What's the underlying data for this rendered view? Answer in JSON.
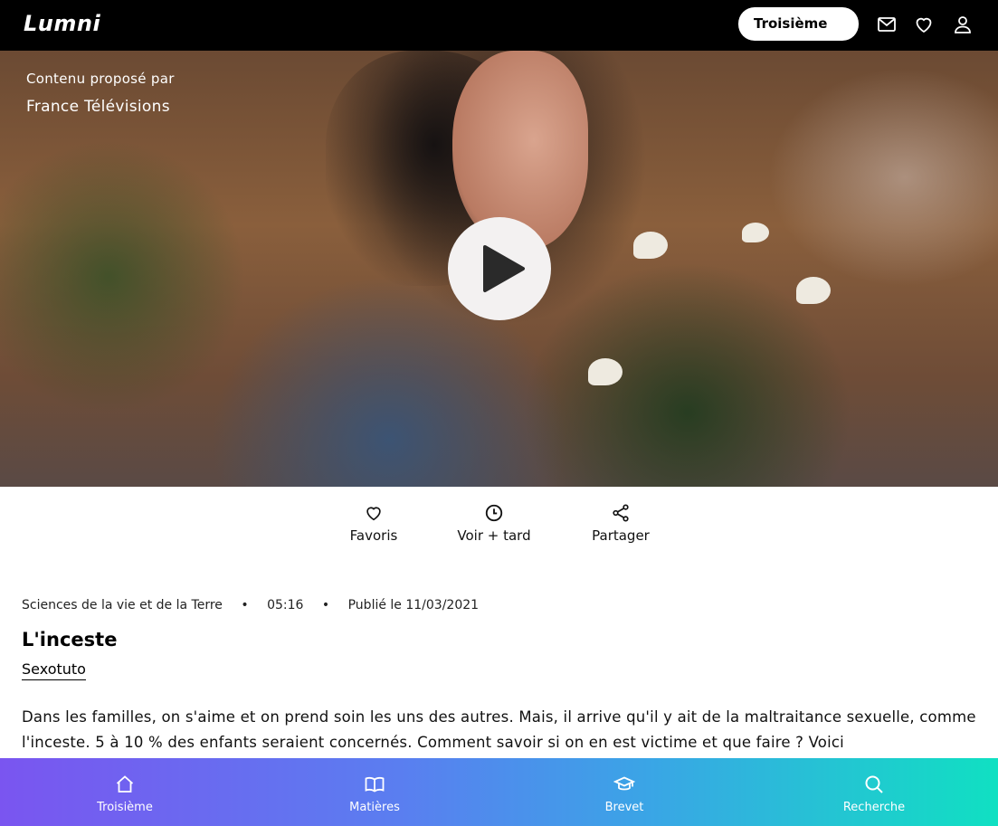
{
  "header": {
    "logo_text": "Lumni",
    "level_label": "Troisième",
    "icons": [
      "mail-icon",
      "heart-icon",
      "user-icon"
    ]
  },
  "video": {
    "provider_line1": "Contenu proposé par",
    "provider_line2": "France Télévisions",
    "play_icon": "play-icon"
  },
  "actions": {
    "favorites_label": "Favoris",
    "watch_later_label": "Voir + tard",
    "share_label": "Partager"
  },
  "content": {
    "subject": "Sciences de la vie et de la Terre",
    "duration": "05:16",
    "published": "Publié le 11/03/2021",
    "separator": "•",
    "title": "L'inceste",
    "program": "Sexotuto",
    "description": "Dans les familles, on s'aime et on prend soin les uns des autres. Mais, il arrive qu'il y ait de la maltraitance sexuelle, comme l'inceste. 5 à 10 % des enfants seraient concernés. Comment savoir si on en est victime et que faire ? Voici"
  },
  "bottom_nav": {
    "items": [
      {
        "label": "Troisième",
        "icon": "home-icon"
      },
      {
        "label": "Matières",
        "icon": "book-icon"
      },
      {
        "label": "Brevet",
        "icon": "graduation-cap-icon"
      },
      {
        "label": "Recherche",
        "icon": "search-icon"
      }
    ]
  },
  "colors": {
    "header_bg": "#000000",
    "nav_gradient_start": "#7a55f0",
    "nav_gradient_end": "#10e0c2"
  }
}
